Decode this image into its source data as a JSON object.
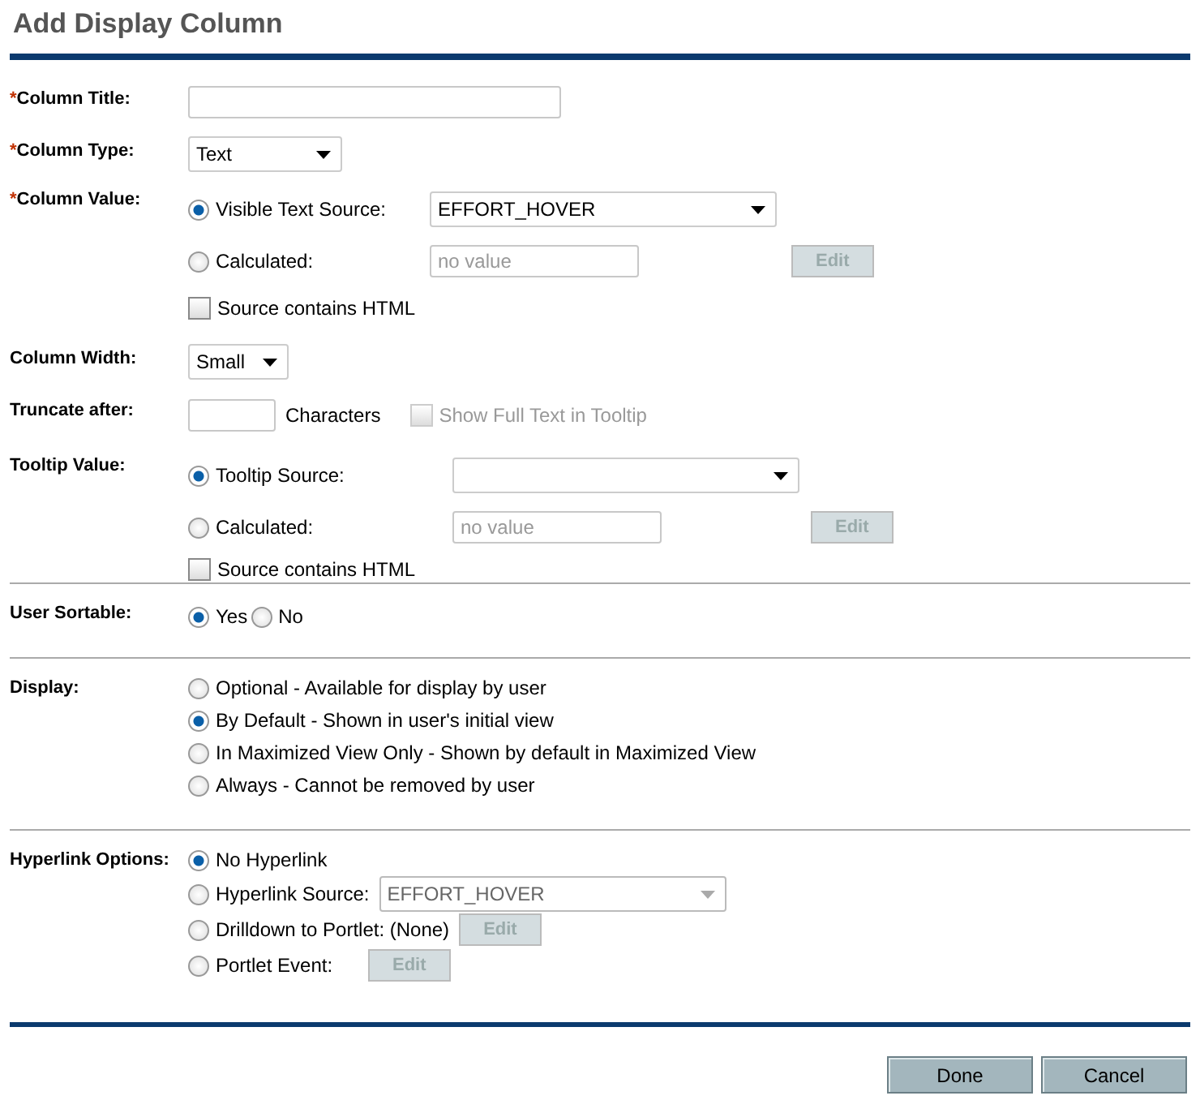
{
  "title": "Add Display Column",
  "column_title": {
    "label": "Column Title:",
    "required_mark": "*"
  },
  "column_type": {
    "label": "Column Type:",
    "required_mark": "*",
    "value": "Text"
  },
  "column_value": {
    "label": "Column Value:",
    "required_mark": "*",
    "source": {
      "label": "Visible Text Source:",
      "selected": true,
      "value": "EFFORT_HOVER"
    },
    "calculated": {
      "label": "Calculated:",
      "selected": false,
      "placeholder": "no value",
      "button": {
        "label": "Edit",
        "disabled": true
      }
    },
    "html_checkbox": {
      "label": "Source contains HTML",
      "checked": false
    }
  },
  "column_width": {
    "label": "Column Width:",
    "value": "Small"
  },
  "truncate": {
    "label": "Truncate after:",
    "unit": "Characters",
    "tooltip_checkbox": {
      "label": "Show Full Text in Tooltip",
      "checked": false,
      "disabled": true
    }
  },
  "tooltip_value": {
    "label": "Tooltip Value:",
    "source": {
      "label": "Tooltip Source:",
      "selected": true
    },
    "calculated": {
      "label": "Calculated:",
      "selected": false,
      "placeholder": "no value",
      "button": {
        "label": "Edit",
        "disabled": true
      }
    },
    "html_checkbox": {
      "label": "Source contains HTML",
      "checked": false
    }
  },
  "user_sortable": {
    "label": "User Sortable:",
    "options": [
      {
        "label": "Yes",
        "selected": true
      },
      {
        "label": "No",
        "selected": false
      }
    ]
  },
  "display": {
    "label": "Display:",
    "options": [
      {
        "label": "Optional - Available for display by user",
        "selected": false
      },
      {
        "label": "By Default - Shown in user's initial view",
        "selected": true
      },
      {
        "label": "In Maximized View Only - Shown by default in Maximized View",
        "selected": false
      },
      {
        "label": "Always - Cannot be removed by user",
        "selected": false
      }
    ]
  },
  "hyperlink_options": {
    "label": "Hyperlink Options:",
    "options": [
      {
        "kind": "plain",
        "label": "No Hyperlink",
        "selected": true
      },
      {
        "kind": "select",
        "label": "Hyperlink Source:",
        "selected": false,
        "value": "EFFORT_HOVER",
        "disabled": true
      },
      {
        "kind": "button",
        "label": "Drilldown to Portlet: (None)",
        "selected": false,
        "button": {
          "label": "Edit",
          "disabled": true
        }
      },
      {
        "kind": "button",
        "label": "Portlet Event:",
        "selected": false,
        "button": {
          "label": "Edit",
          "disabled": true
        }
      }
    ]
  },
  "buttons": [
    {
      "label": "Done"
    },
    {
      "label": "Cancel"
    }
  ]
}
